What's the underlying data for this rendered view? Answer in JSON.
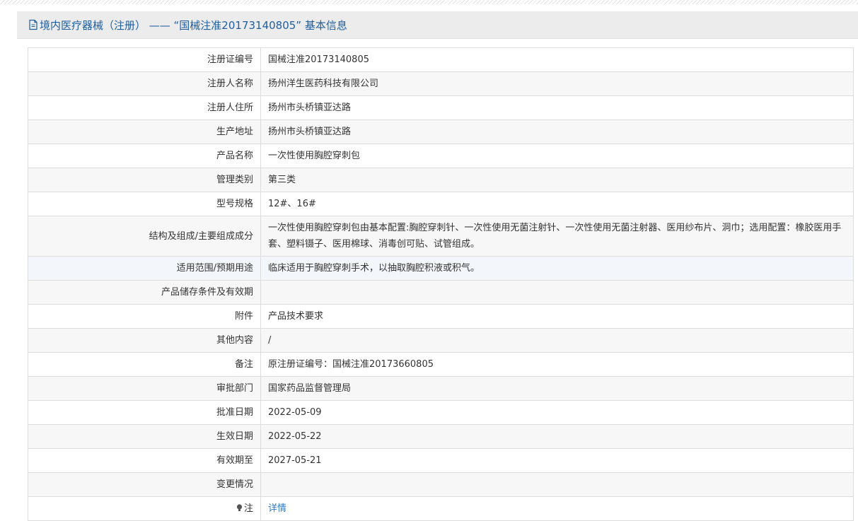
{
  "header": {
    "title": "境内医疗器械（注册） —— “国械注准20173140805” 基本信息"
  },
  "rows": [
    {
      "label": "注册证编号",
      "value": "国械注准20173140805"
    },
    {
      "label": "注册人名称",
      "value": "扬州洋生医药科技有限公司"
    },
    {
      "label": "注册人住所",
      "value": "扬州市头桥镇亚达路"
    },
    {
      "label": "生产地址",
      "value": "扬州市头桥镇亚达路"
    },
    {
      "label": "产品名称",
      "value": "一次性使用胸腔穿刺包"
    },
    {
      "label": "管理类别",
      "value": "第三类"
    },
    {
      "label": "型号规格",
      "value": "12#、16#"
    },
    {
      "label": "结构及组成/主要组成成分",
      "value": "一次性使用胸腔穿刺包由基本配置:胸腔穿刺针、一次性使用无菌注射针、一次性使用无菌注射器、医用纱布片、洞巾；选用配置：橡胶医用手套、塑料镊子、医用棉球、消毒创可贴、试管组成。"
    },
    {
      "label": "适用范围/预期用途",
      "value": "临床适用于胸腔穿刺手术，以抽取胸腔积液或积气。"
    },
    {
      "label": "产品储存条件及有效期",
      "value": ""
    },
    {
      "label": "附件",
      "value": "产品技术要求"
    },
    {
      "label": "其他内容",
      "value": "/"
    },
    {
      "label": "备注",
      "value": "原注册证编号：国械注准20173660805"
    },
    {
      "label": "审批部门",
      "value": "国家药品监督管理局"
    },
    {
      "label": "批准日期",
      "value": "2022-05-09"
    },
    {
      "label": "生效日期",
      "value": "2022-05-22"
    },
    {
      "label": "有效期至",
      "value": "2027-05-21"
    },
    {
      "label": "变更情况",
      "value": ""
    }
  ],
  "note_row": {
    "label": "注",
    "link": "详情",
    "icon": "lightbulb-icon"
  },
  "colors": {
    "header_text": "#1f5e9e",
    "link": "#2a7ac8",
    "border": "#dcdcdc",
    "alt_row": "#f7f7f7"
  }
}
